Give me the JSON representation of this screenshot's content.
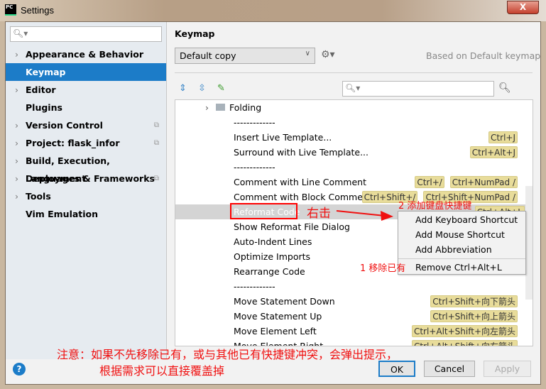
{
  "window": {
    "title": "Settings",
    "app_icon": "PC",
    "close": "X"
  },
  "sidebar": {
    "items": [
      {
        "label": "Appearance & Behavior",
        "chevron": true
      },
      {
        "label": "Keymap",
        "selected": true
      },
      {
        "label": "Editor",
        "chevron": true
      },
      {
        "label": "Plugins"
      },
      {
        "label": "Version Control",
        "chevron": true,
        "copy_icon": true
      },
      {
        "label": "Project: flask_infor",
        "chevron": true,
        "copy_icon": true
      },
      {
        "label": "Build, Execution, Deployment",
        "chevron": true
      },
      {
        "label": "Languages & Frameworks",
        "chevron": true,
        "copy_icon": true
      },
      {
        "label": "Tools",
        "chevron": true
      },
      {
        "label": "Vim Emulation"
      }
    ]
  },
  "main": {
    "title": "Keymap",
    "keymap_select": "Default copy",
    "based_on": "Based on Default keymap"
  },
  "list": {
    "folder": "Folding",
    "rows": [
      {
        "label": "-------------",
        "keys": []
      },
      {
        "label": "Insert Live Template...",
        "keys": [
          "Ctrl+J"
        ]
      },
      {
        "label": "Surround with Live Template...",
        "keys": [
          "Ctrl+Alt+J"
        ]
      },
      {
        "label": "-------------",
        "keys": []
      },
      {
        "label": "Comment with Line Comment",
        "keys": [
          "Ctrl+/",
          "Ctrl+NumPad /"
        ]
      },
      {
        "label": "Comment with Block Comment",
        "keys": [
          "Ctrl+Shift+/",
          "Ctrl+Shift+NumPad /"
        ]
      },
      {
        "label": "Reformat Code",
        "keys": [
          "Ctrl+Alt+L"
        ],
        "selected": true
      },
      {
        "label": "Show Reformat File Dialog",
        "keys": []
      },
      {
        "label": "Auto-Indent Lines",
        "keys": []
      },
      {
        "label": "Optimize Imports",
        "keys": []
      },
      {
        "label": "Rearrange Code",
        "keys": []
      },
      {
        "label": "-------------",
        "keys": []
      },
      {
        "label": "Move Statement Down",
        "keys": [
          "Ctrl+Shift+向下箭头"
        ]
      },
      {
        "label": "Move Statement Up",
        "keys": [
          "Ctrl+Shift+向上箭头"
        ]
      },
      {
        "label": "Move Element Left",
        "keys": [
          "Ctrl+Alt+Shift+向左箭头"
        ]
      },
      {
        "label": "Move Element Right",
        "keys": [
          "Ctrl+Alt+Shift+向右箭头"
        ]
      }
    ]
  },
  "context_menu": {
    "items": [
      "Add Keyboard Shortcut",
      "Add Mouse Shortcut",
      "Add Abbreviation",
      "Remove Ctrl+Alt+L"
    ]
  },
  "annotations": {
    "right_click": "右击",
    "step2": "2 添加键盘快捷键",
    "step1": "1 移除已有",
    "note_line1": "注意：如果不先移除已有，或与其他已有快捷键冲突，会弹出提示，",
    "note_line2": "根据需求可以直接覆盖掉",
    "color": "#f01010"
  },
  "buttons": {
    "ok": "OK",
    "cancel": "Cancel",
    "apply": "Apply",
    "help": "?"
  }
}
